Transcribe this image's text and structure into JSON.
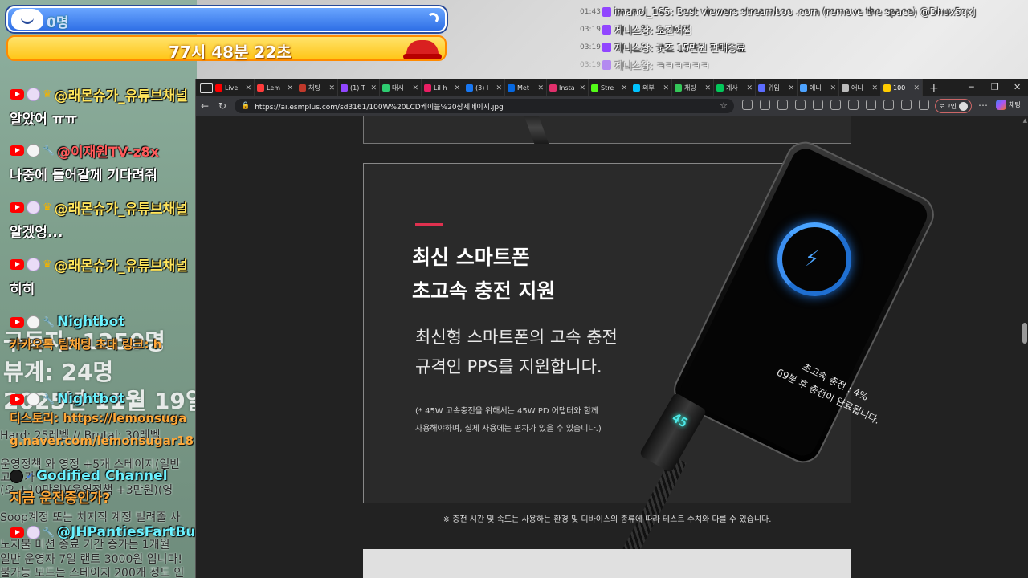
{
  "overlay": {
    "subscriber_count": "0명",
    "timer": "77시 48분 22초"
  },
  "chat": [
    {
      "name": "@래몬슈가_유튜브채널",
      "text": "알았어 ㅠㅠ",
      "name_color": "yellow"
    },
    {
      "name": "@이재원TV-z8x",
      "text": "나중에 들어갈께 기다려줘",
      "name_color": "red"
    },
    {
      "name": "@래몬슈가_유튜브채널",
      "text": "알겠엉...",
      "name_color": "yellow"
    },
    {
      "name": "@래몬슈가_유튜브채널",
      "text": "히히",
      "name_color": "yellow"
    },
    {
      "name": "Nightbot",
      "text": "카카오톡 팀채팅 초대 링크: h",
      "name_color": "teal"
    },
    {
      "name": "Nightbot",
      "text": "티스토리: https://lemonsuga",
      "name_color": "teal"
    },
    {
      "name": "Godified Channel",
      "text": "지금 운전중인가?",
      "name_color": "teal"
    },
    {
      "name": "@JHPantiesFartButt",
      "text": "",
      "name_color": "teal"
    }
  ],
  "stream_overlay_text": {
    "subs_big": "구독자: 1250명",
    "today_big": "뷰계: 24명",
    "date_big": "2025년 11월 19일",
    "naver_line": "g.naver.com/lemonsugar18",
    "lines": [
      "Hard: 25레벨 // Brutal: 30레벨",
      "운영정책 와 영정 +5개 스테이지(일반",
      "고 추가",
      "(오 +10만원)(운영정책 +3만원)(영",
      "Soop계정 또는 치지직 계정 빌려줄 사",
      "노지불 미션 종료 기간 증가는 1개월",
      "일반 운영자 7일 랜트 3000원 입니다!",
      "불가능 모드는 스테이지 200개 정도 인"
    ]
  },
  "twitch_chat": [
    {
      "time": "01:43",
      "text": "imanol_165: Best viewers streamboo .com (remove the space) @Dhux5qxJ"
    },
    {
      "time": "03:19",
      "text": "제니스왕: 오진어쩜"
    },
    {
      "time": "03:19",
      "text": "제니스왕: 굿즈 15만원 판매종료"
    },
    {
      "time": "03:19",
      "text": "제니스왕: ㅋㅋㅋㅋㅋㅋ"
    }
  ],
  "browser": {
    "tabs": [
      {
        "label": "Live",
        "color": "#ff0000"
      },
      {
        "label": "Lem",
        "color": "#ff3b3b"
      },
      {
        "label": "채팅",
        "color": "#c0392b"
      },
      {
        "label": "(1) T",
        "color": "#9146ff"
      },
      {
        "label": "대시",
        "color": "#2ecc71"
      },
      {
        "label": "Lil h",
        "color": "#e91e63"
      },
      {
        "label": "(3) I",
        "color": "#1877f2"
      },
      {
        "label": "Met",
        "color": "#0668e1"
      },
      {
        "label": "Insta",
        "color": "#e1306c"
      },
      {
        "label": "Stre",
        "color": "#53fc18"
      },
      {
        "label": "외부",
        "color": "#00c3ff"
      },
      {
        "label": "채팅",
        "color": "#34c759"
      },
      {
        "label": "계사",
        "color": "#03c75a"
      },
      {
        "label": "위임",
        "color": "#5b6cff"
      },
      {
        "label": "애니",
        "color": "#4da3ff"
      },
      {
        "label": "애니",
        "color": "#bbbbbb"
      },
      {
        "label": "100",
        "color": "#ffcc00"
      }
    ],
    "url": "https://ai.esmplus.com/sd3161/100W%20LCD케이블%20상세페이지.jpg",
    "profile_label": "로그인",
    "copilot_label": "채팅"
  },
  "product": {
    "heading_line1": "최신 스마트폰",
    "heading_line2": "초고속 충전 지원",
    "desc_line1": "최신형 스마트폰의 고속 충전",
    "desc_line2": "규격인 PPS를 지원합니다.",
    "note_line1": "(* 45W 고속충전을 위해서는 45W PD 어댑터와 함께",
    "note_line2": "사용해야하며, 실제 사용에는 편차가 있을 수 있습니다.)",
    "screen_line1": "초고속 충전 : 4%",
    "screen_line2": "69분 후 충전이 완료됩니다.",
    "led_value": "45",
    "footnote": "※ 충전 시간 및 속도는 사용하는 환경 및 디바이스의 종류에 따라 테스트 수치와 다를 수 있습니다."
  },
  "colors": {
    "accent": "#e0314f",
    "ring": "#1f6fd1",
    "led": "#4fe8e8"
  }
}
